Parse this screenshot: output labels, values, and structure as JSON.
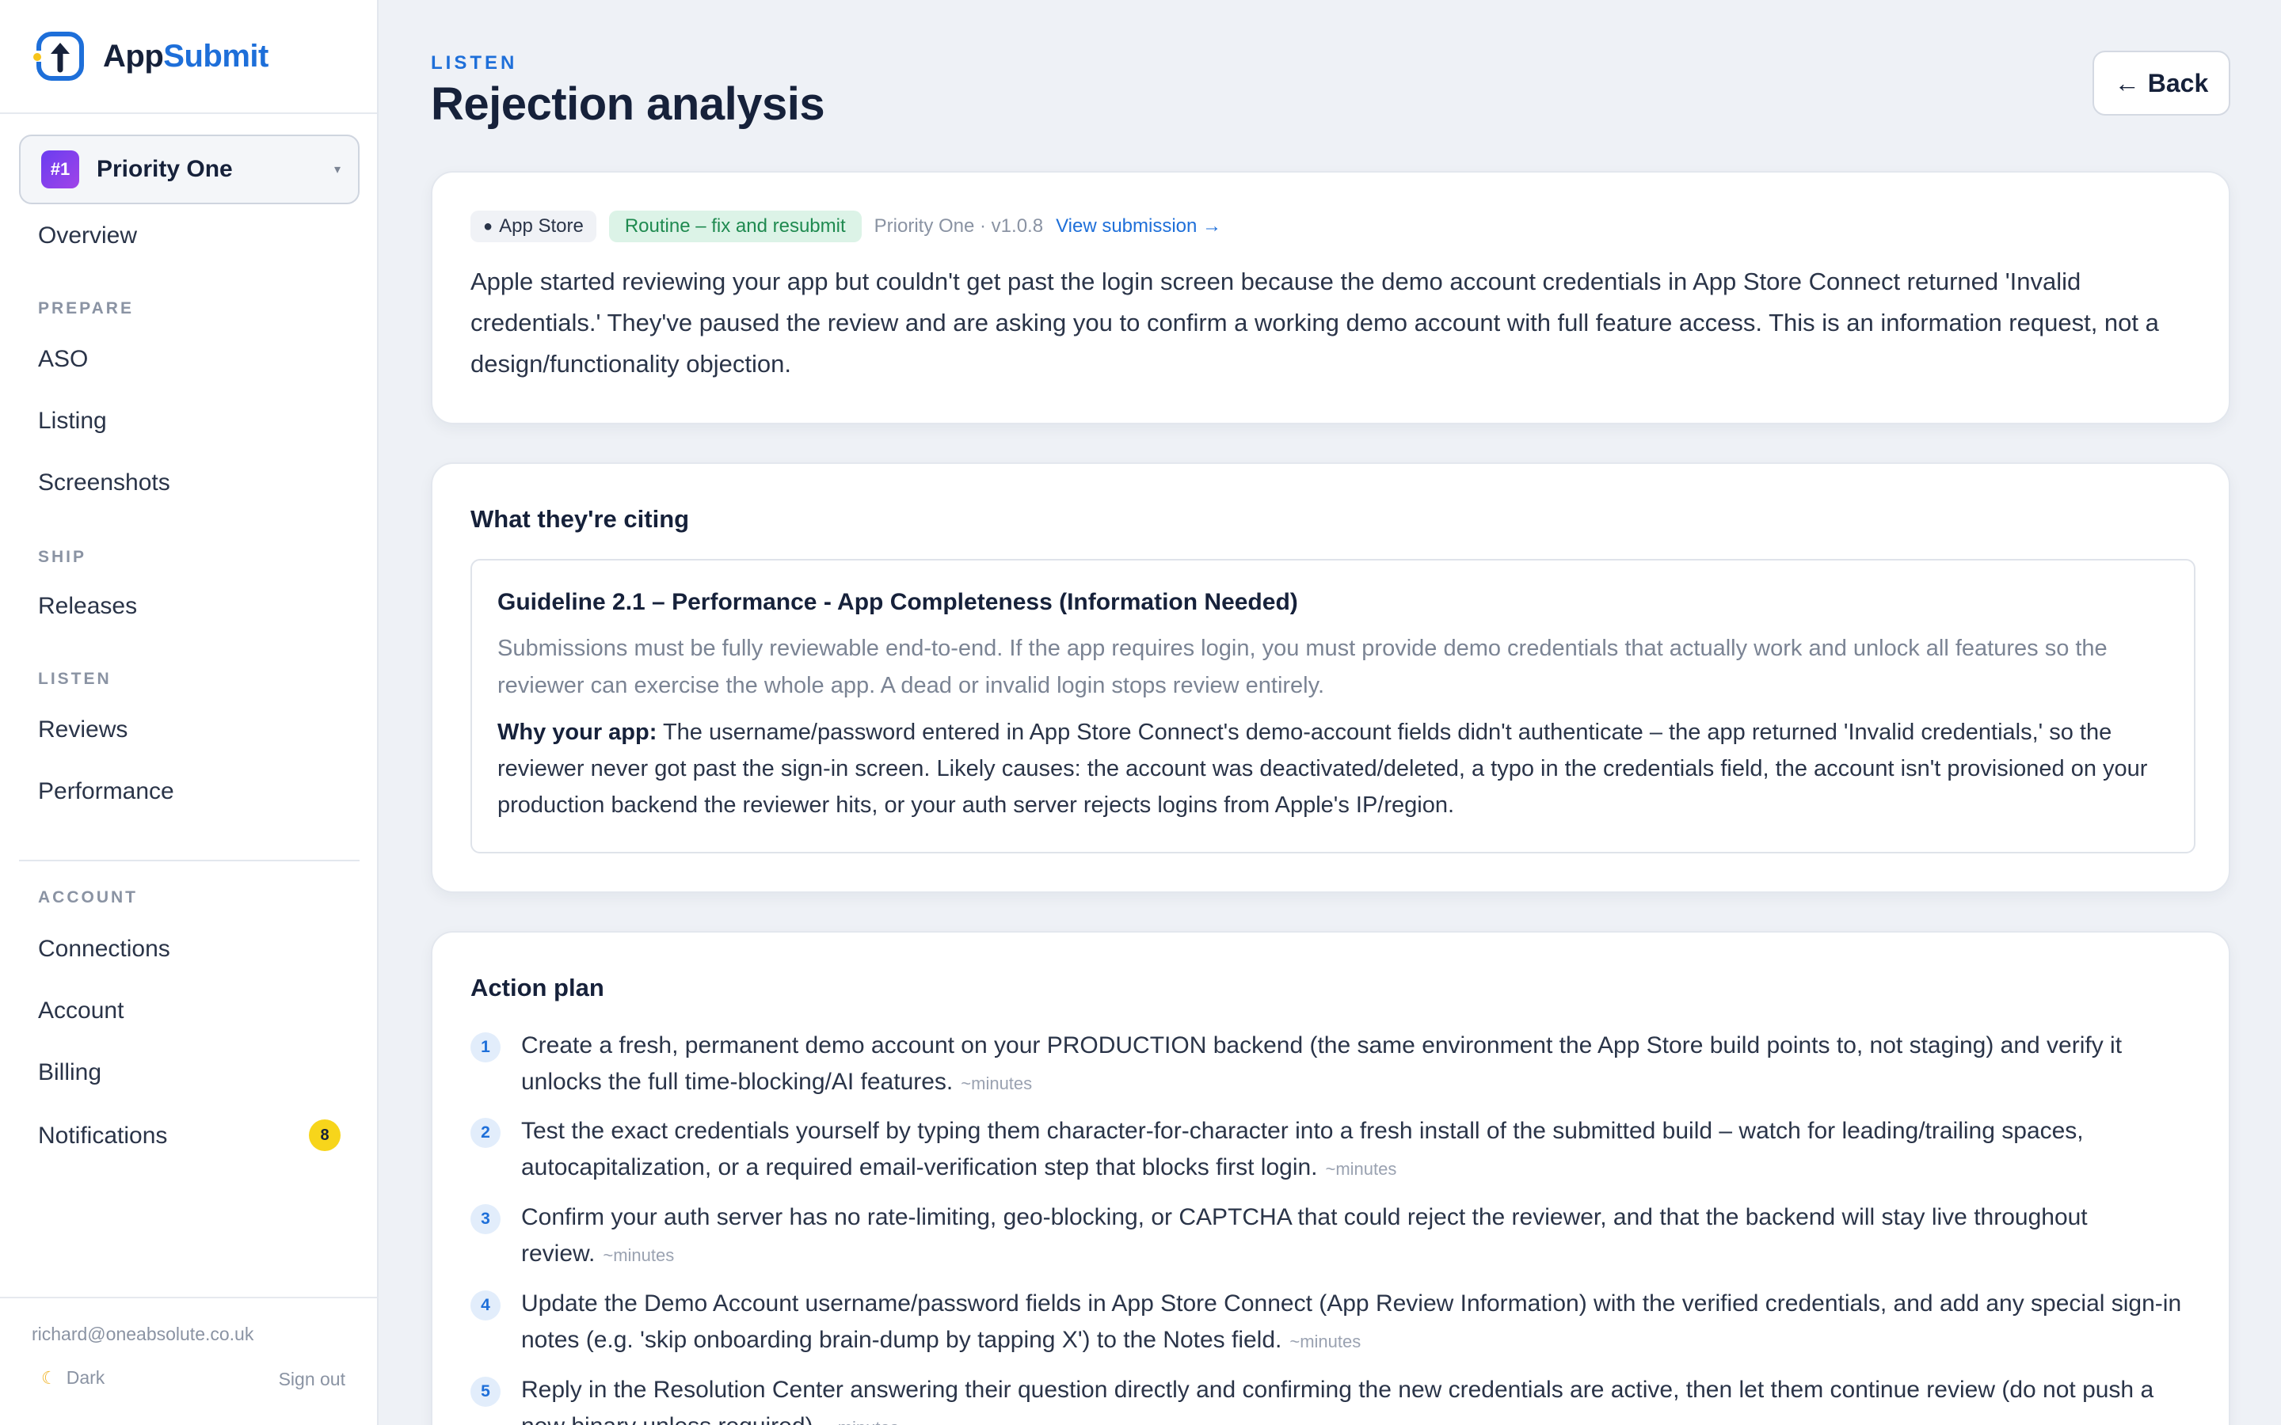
{
  "brand": {
    "app": "App",
    "submit": "Submit"
  },
  "app_switcher": {
    "badge": "#1",
    "name": "Priority One",
    "caret": "▾"
  },
  "sidebar": {
    "overview": "Overview",
    "sections": {
      "prepare": "PREPARE",
      "ship": "SHIP",
      "listen": "LISTEN",
      "account": "ACCOUNT"
    },
    "items": {
      "aso": "ASO",
      "listing": "Listing",
      "screenshots": "Screenshots",
      "releases": "Releases",
      "reviews": "Reviews",
      "performance": "Performance",
      "connections": "Connections",
      "account": "Account",
      "billing": "Billing",
      "notifications": "Notifications"
    },
    "notifications_count": "8",
    "user_email": "richard@oneabsolute.co.uk",
    "theme_label": "Dark",
    "sign_out": "Sign out"
  },
  "header": {
    "eyebrow": "LISTEN",
    "title": "Rejection analysis",
    "back_label": "Back"
  },
  "summary": {
    "store": "App Store",
    "severity": "Routine – fix and resubmit",
    "version": "Priority One · v1.0.8",
    "view_link": "View submission →",
    "text": "Apple started reviewing your app but couldn't get past the login screen because the demo account credentials in App Store Connect returned 'Invalid credentials.' They've paused the review and are asking you to confirm a working demo account with full feature access. This is an information request, not a design/functionality objection."
  },
  "citing": {
    "heading": "What they're citing",
    "guideline_title": "Guideline 2.1 – Performance - App Completeness (Information Needed)",
    "guideline_desc": "Submissions must be fully reviewable end-to-end. If the app requires login, you must provide demo credentials that actually work and unlock all features so the reviewer can exercise the whole app. A dead or invalid login stops review entirely.",
    "why_label": "Why your app:",
    "why_text": "The username/password entered in App Store Connect's demo-account fields didn't authenticate – the app returned 'Invalid credentials,' so the reviewer never got past the sign-in screen. Likely causes: the account was deactivated/deleted, a typo in the credentials field, the account isn't provisioned on your production backend the reviewer hits, or your auth server rejects logins from Apple's IP/region."
  },
  "plan": {
    "heading": "Action plan",
    "steps": [
      {
        "num": "1",
        "text": "Create a fresh, permanent demo account on your PRODUCTION backend (the same environment the App Store build points to, not staging) and verify it unlocks the full time-blocking/AI features.",
        "est": "~minutes"
      },
      {
        "num": "2",
        "text": "Test the exact credentials yourself by typing them character-for-character into a fresh install of the submitted build – watch for leading/trailing spaces, autocapitalization, or a required email-verification step that blocks first login.",
        "est": "~minutes"
      },
      {
        "num": "3",
        "text": "Confirm your auth server has no rate-limiting, geo-blocking, or CAPTCHA that could reject the reviewer, and that the backend will stay live throughout review.",
        "est": "~minutes"
      },
      {
        "num": "4",
        "text": "Update the Demo Account username/password fields in App Store Connect (App Review Information) with the verified credentials, and add any special sign-in notes (e.g. 'skip onboarding brain-dump by tapping X') to the Notes field.",
        "est": "~minutes"
      },
      {
        "num": "5",
        "text": "Reply in the Resolution Center answering their question directly and confirming the new credentials are active, then let them continue review (do not push a new binary unless required).",
        "est": "~minutes"
      }
    ]
  }
}
